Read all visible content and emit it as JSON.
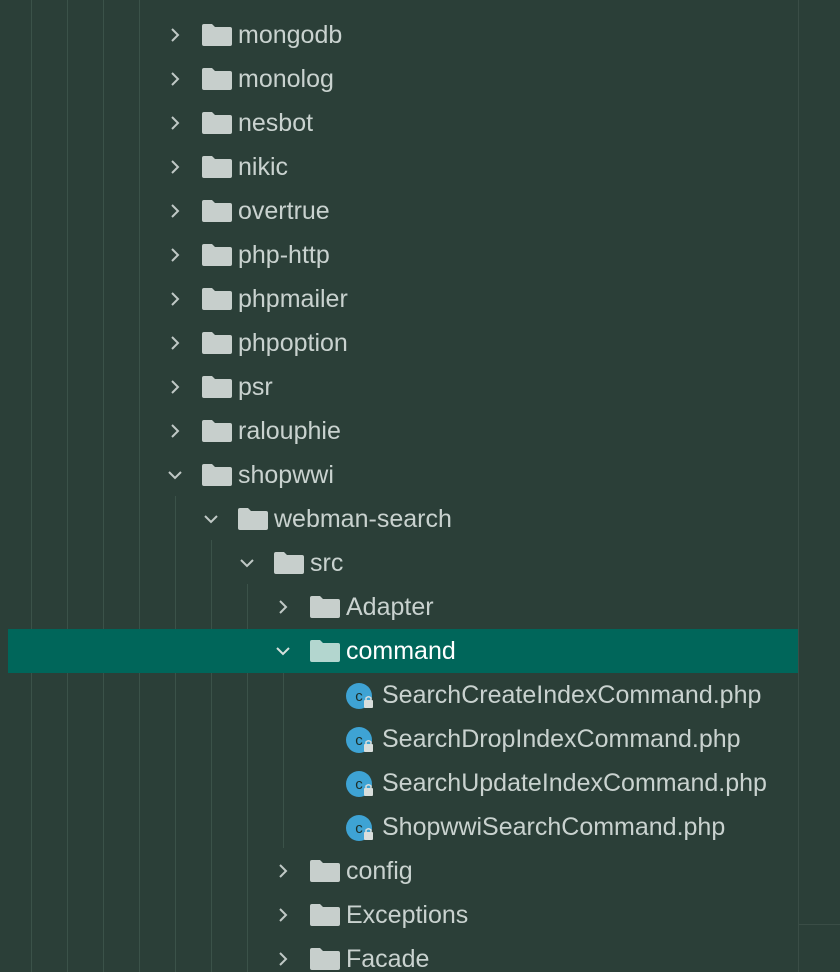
{
  "project_tree": {
    "items": [
      {
        "label": "mongodb",
        "kind": "folder",
        "expanded": false
      },
      {
        "label": "monolog",
        "kind": "folder",
        "expanded": false
      },
      {
        "label": "nesbot",
        "kind": "folder",
        "expanded": false
      },
      {
        "label": "nikic",
        "kind": "folder",
        "expanded": false
      },
      {
        "label": "overtrue",
        "kind": "folder",
        "expanded": false
      },
      {
        "label": "php-http",
        "kind": "folder",
        "expanded": false
      },
      {
        "label": "phpmailer",
        "kind": "folder",
        "expanded": false
      },
      {
        "label": "phpoption",
        "kind": "folder",
        "expanded": false
      },
      {
        "label": "psr",
        "kind": "folder",
        "expanded": false
      },
      {
        "label": "ralouphie",
        "kind": "folder",
        "expanded": false
      },
      {
        "label": "shopwwi",
        "kind": "folder",
        "expanded": true
      },
      {
        "label": "webman-search",
        "kind": "folder",
        "expanded": true
      },
      {
        "label": "src",
        "kind": "folder",
        "expanded": true
      },
      {
        "label": "Adapter",
        "kind": "folder",
        "expanded": false
      },
      {
        "label": "command",
        "kind": "folder",
        "expanded": true,
        "selected": true
      },
      {
        "label": "SearchCreateIndexCommand.php",
        "kind": "php-class"
      },
      {
        "label": "SearchDropIndexCommand.php",
        "kind": "php-class"
      },
      {
        "label": "SearchUpdateIndexCommand.php",
        "kind": "php-class"
      },
      {
        "label": "ShopwwiSearchCommand.php",
        "kind": "php-class"
      },
      {
        "label": "config",
        "kind": "folder",
        "expanded": false
      },
      {
        "label": "Exceptions",
        "kind": "folder",
        "expanded": false
      },
      {
        "label": "Facade",
        "kind": "folder",
        "expanded": false
      }
    ]
  },
  "colors": {
    "background": "#2b3f38",
    "selection": "#00665a",
    "text": "#c9d2cf",
    "folder_icon": "#c7cfcc",
    "class_icon": "#3ea3d4"
  },
  "icons": {
    "collapsed": "chevron-right-icon",
    "expanded": "chevron-down-icon",
    "folder": "folder-icon",
    "php_class": "php-class-icon"
  }
}
